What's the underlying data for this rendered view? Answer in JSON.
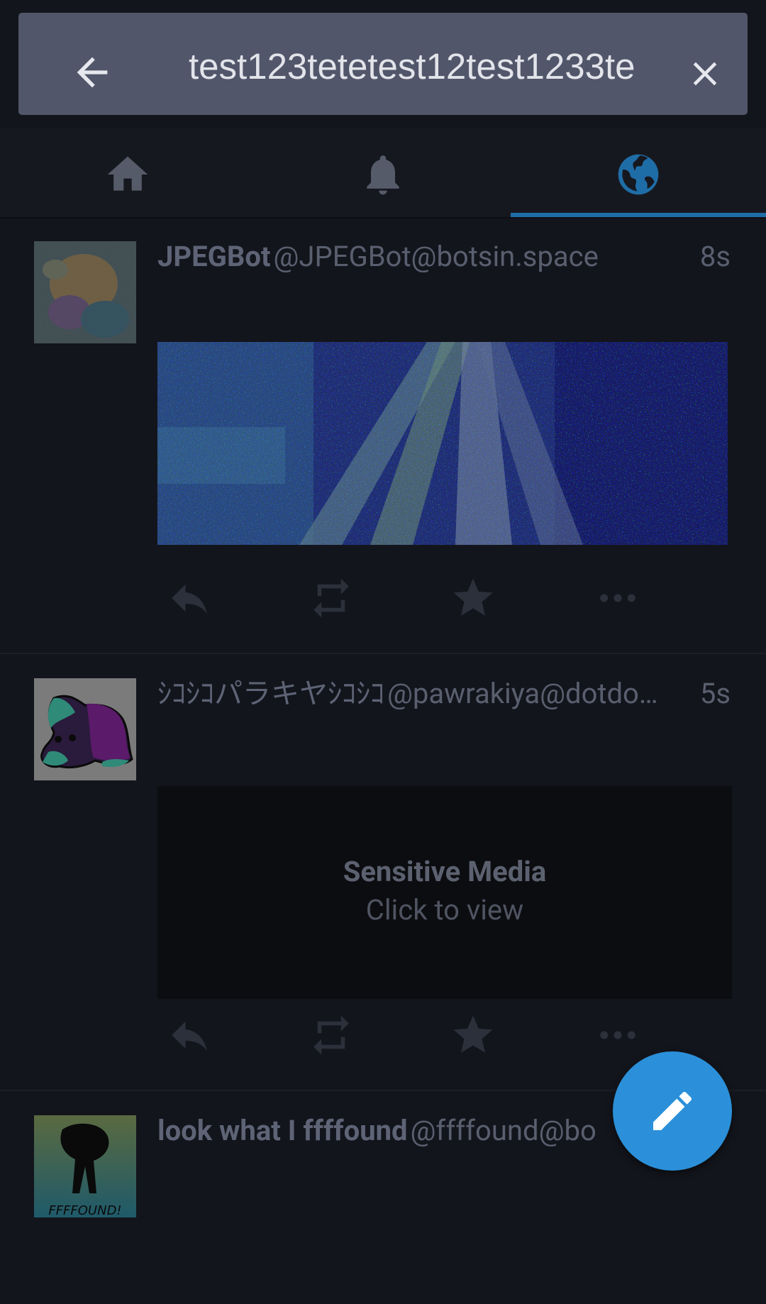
{
  "search": {
    "value": "test123tetetest12test1233te",
    "back_icon": "arrow-left-icon",
    "clear_icon": "close-icon"
  },
  "tabs": [
    {
      "icon": "home-icon",
      "active": false
    },
    {
      "icon": "bell-icon",
      "active": false
    },
    {
      "icon": "globe-icon",
      "active": true
    }
  ],
  "statuses": [
    {
      "display_name": "JPEGBot",
      "handle": "@JPEGBot@botsin.space",
      "time": "8s",
      "media": "image"
    },
    {
      "display_name": "ｼｺｼｺパラキヤｼｺｼｺ",
      "handle": "@pawrakiya@dotdo…",
      "time": "5s",
      "media": "sensitive",
      "sensitive_title": "Sensitive Media",
      "sensitive_subtitle": "Click to view"
    },
    {
      "display_name": "look what I ffffound",
      "handle": "@ffffound@bo",
      "avatar_text": "FFFFOUND!"
    }
  ],
  "actions": [
    "reply-icon",
    "boost-icon",
    "favourite-icon",
    "more-icon"
  ],
  "fab_icon": "pencil-icon",
  "colors": {
    "accent": "#2b90d9",
    "background": "#13151c",
    "search_bar": "#51566a"
  }
}
